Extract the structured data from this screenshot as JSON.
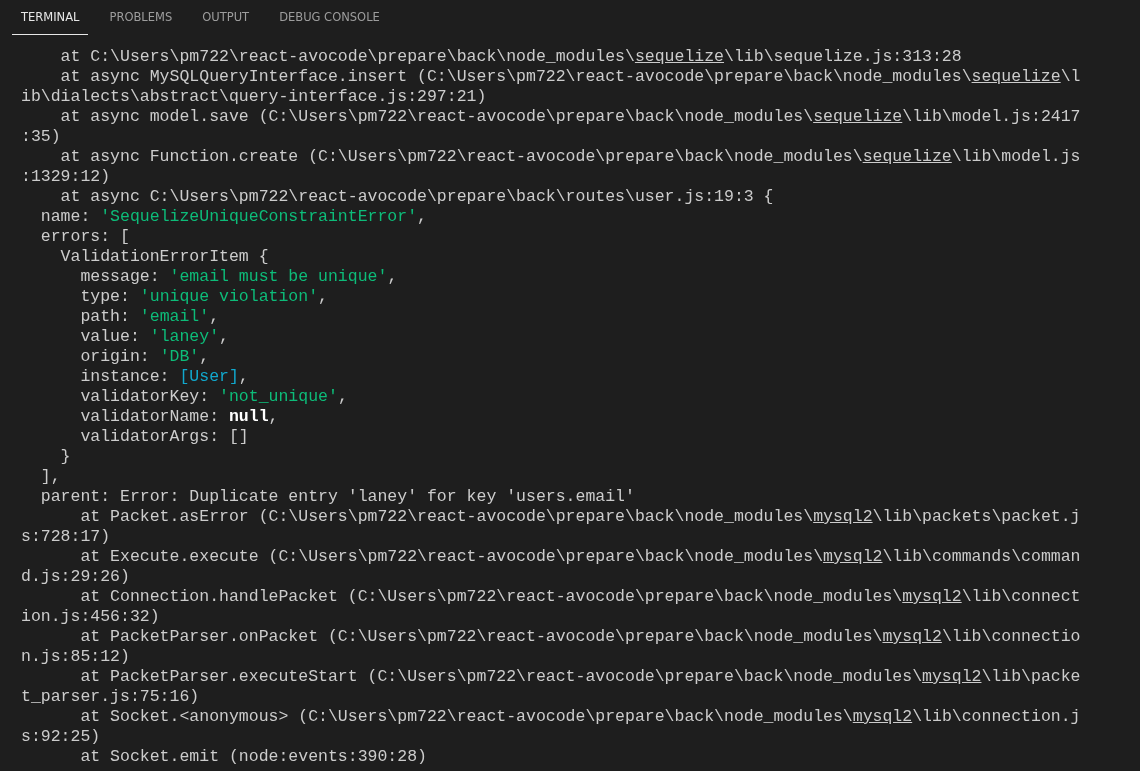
{
  "tabs": [
    {
      "label": "TERMINAL",
      "selected": true
    },
    {
      "label": "PROBLEMS",
      "selected": false
    },
    {
      "label": "OUTPUT",
      "selected": false
    },
    {
      "label": "DEBUG CONSOLE",
      "selected": false
    }
  ],
  "terminal": {
    "lines": [
      [
        {
          "kind": "text",
          "text": "    at C:\\Users\\pm722\\react-avocode\\prepare\\back\\node_modules\\"
        },
        {
          "kind": "link",
          "text": "sequelize"
        },
        {
          "kind": "text",
          "text": "\\lib\\sequelize.js:313:28"
        }
      ],
      [
        {
          "kind": "text",
          "text": "    at async MySQLQueryInterface.insert (C:\\Users\\pm722\\react-avocode\\prepare\\back\\node_modules\\"
        },
        {
          "kind": "link",
          "text": "sequelize"
        },
        {
          "kind": "text",
          "text": "\\l"
        }
      ],
      [
        {
          "kind": "text",
          "text": "ib\\dialects\\abstract\\query-interface.js:297:21)"
        }
      ],
      [
        {
          "kind": "text",
          "text": "    at async model.save (C:\\Users\\pm722\\react-avocode\\prepare\\back\\node_modules\\"
        },
        {
          "kind": "link",
          "text": "sequelize"
        },
        {
          "kind": "text",
          "text": "\\lib\\model.js:2417"
        }
      ],
      [
        {
          "kind": "text",
          "text": ":35)"
        }
      ],
      [
        {
          "kind": "text",
          "text": "    at async Function.create (C:\\Users\\pm722\\react-avocode\\prepare\\back\\node_modules\\"
        },
        {
          "kind": "link",
          "text": "sequelize"
        },
        {
          "kind": "text",
          "text": "\\lib\\model.js"
        }
      ],
      [
        {
          "kind": "text",
          "text": ":1329:12)"
        }
      ],
      [
        {
          "kind": "text",
          "text": "    at async C:\\Users\\pm722\\react-avocode\\prepare\\back\\routes\\user.js:19:3 {"
        }
      ],
      [
        {
          "kind": "text",
          "text": "  name: "
        },
        {
          "kind": "string",
          "text": "'SequelizeUniqueConstraintError'"
        },
        {
          "kind": "text",
          "text": ","
        }
      ],
      [
        {
          "kind": "text",
          "text": "  errors: ["
        }
      ],
      [
        {
          "kind": "text",
          "text": "    ValidationErrorItem {"
        }
      ],
      [
        {
          "kind": "text",
          "text": "      message: "
        },
        {
          "kind": "string",
          "text": "'email must be unique'"
        },
        {
          "kind": "text",
          "text": ","
        }
      ],
      [
        {
          "kind": "text",
          "text": "      type: "
        },
        {
          "kind": "string",
          "text": "'unique violation'"
        },
        {
          "kind": "text",
          "text": ","
        }
      ],
      [
        {
          "kind": "text",
          "text": "      path: "
        },
        {
          "kind": "string",
          "text": "'email'"
        },
        {
          "kind": "text",
          "text": ","
        }
      ],
      [
        {
          "kind": "text",
          "text": "      value: "
        },
        {
          "kind": "string",
          "text": "'laney'"
        },
        {
          "kind": "text",
          "text": ","
        }
      ],
      [
        {
          "kind": "text",
          "text": "      origin: "
        },
        {
          "kind": "string",
          "text": "'DB'"
        },
        {
          "kind": "text",
          "text": ","
        }
      ],
      [
        {
          "kind": "text",
          "text": "      instance: "
        },
        {
          "kind": "ref",
          "text": "[User]"
        },
        {
          "kind": "text",
          "text": ","
        }
      ],
      [
        {
          "kind": "text",
          "text": "      validatorKey: "
        },
        {
          "kind": "string",
          "text": "'not_unique'"
        },
        {
          "kind": "text",
          "text": ","
        }
      ],
      [
        {
          "kind": "text",
          "text": "      validatorName: "
        },
        {
          "kind": "keyword",
          "text": "null"
        },
        {
          "kind": "text",
          "text": ","
        }
      ],
      [
        {
          "kind": "text",
          "text": "      validatorArgs: []"
        }
      ],
      [
        {
          "kind": "text",
          "text": "    }"
        }
      ],
      [
        {
          "kind": "text",
          "text": "  ],"
        }
      ],
      [
        {
          "kind": "text",
          "text": "  parent: Error: Duplicate entry 'laney' for key 'users.email'"
        }
      ],
      [
        {
          "kind": "text",
          "text": "      at Packet.asError (C:\\Users\\pm722\\react-avocode\\prepare\\back\\node_modules\\"
        },
        {
          "kind": "link",
          "text": "mysql2"
        },
        {
          "kind": "text",
          "text": "\\lib\\packets\\packet.j"
        }
      ],
      [
        {
          "kind": "text",
          "text": "s:728:17)"
        }
      ],
      [
        {
          "kind": "text",
          "text": "      at Execute.execute (C:\\Users\\pm722\\react-avocode\\prepare\\back\\node_modules\\"
        },
        {
          "kind": "link",
          "text": "mysql2"
        },
        {
          "kind": "text",
          "text": "\\lib\\commands\\comman"
        }
      ],
      [
        {
          "kind": "text",
          "text": "d.js:29:26)"
        }
      ],
      [
        {
          "kind": "text",
          "text": "      at Connection.handlePacket (C:\\Users\\pm722\\react-avocode\\prepare\\back\\node_modules\\"
        },
        {
          "kind": "link",
          "text": "mysql2"
        },
        {
          "kind": "text",
          "text": "\\lib\\connect"
        }
      ],
      [
        {
          "kind": "text",
          "text": "ion.js:456:32)"
        }
      ],
      [
        {
          "kind": "text",
          "text": "      at PacketParser.onPacket (C:\\Users\\pm722\\react-avocode\\prepare\\back\\node_modules\\"
        },
        {
          "kind": "link",
          "text": "mysql2"
        },
        {
          "kind": "text",
          "text": "\\lib\\connectio"
        }
      ],
      [
        {
          "kind": "text",
          "text": "n.js:85:12)"
        }
      ],
      [
        {
          "kind": "text",
          "text": "      at PacketParser.executeStart (C:\\Users\\pm722\\react-avocode\\prepare\\back\\node_modules\\"
        },
        {
          "kind": "link",
          "text": "mysql2"
        },
        {
          "kind": "text",
          "text": "\\lib\\packe"
        }
      ],
      [
        {
          "kind": "text",
          "text": "t_parser.js:75:16)"
        }
      ],
      [
        {
          "kind": "text",
          "text": "      at Socket.<anonymous> (C:\\Users\\pm722\\react-avocode\\prepare\\back\\node_modules\\"
        },
        {
          "kind": "link",
          "text": "mysql2"
        },
        {
          "kind": "text",
          "text": "\\lib\\connection.j"
        }
      ],
      [
        {
          "kind": "text",
          "text": "s:92:25)"
        }
      ],
      [
        {
          "kind": "text",
          "text": "      at Socket.emit (node:events:390:28)"
        }
      ]
    ]
  }
}
